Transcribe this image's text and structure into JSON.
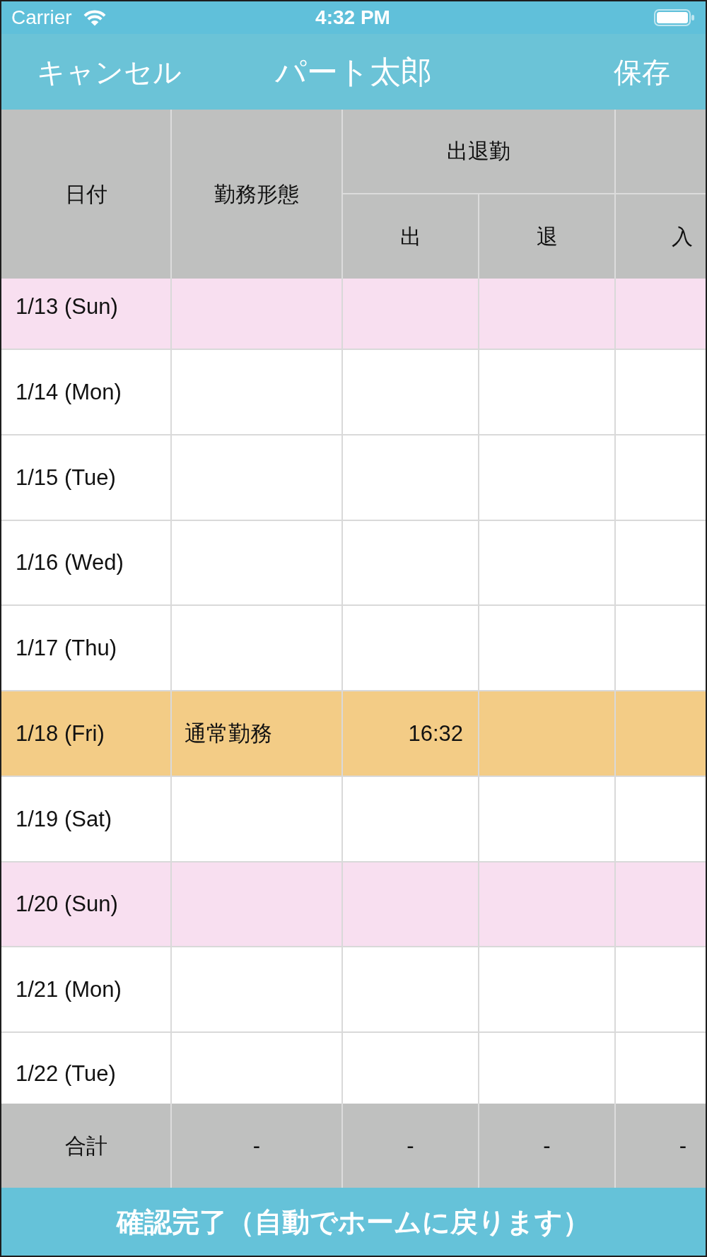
{
  "status_bar": {
    "carrier": "Carrier",
    "time": "4:32 PM"
  },
  "nav_bar": {
    "cancel_button": "キャンセル",
    "title": "パート太郎",
    "save_button": "保存"
  },
  "table": {
    "columns": [
      {
        "label": "日付"
      },
      {
        "label": "勤務形態"
      },
      {
        "label": "出退勤",
        "children": [
          {
            "label": "出"
          },
          {
            "label": "退"
          }
        ]
      },
      {
        "children": [
          {
            "label": "入"
          }
        ]
      }
    ],
    "rows": [
      {
        "date": "1/13 (Sun)",
        "color": "#f8dff0"
      },
      {
        "date": "1/14 (Mon)",
        "color": "#ffffff"
      },
      {
        "date": "1/15 (Tue)",
        "color": "#ffffff"
      },
      {
        "date": "1/16 (Wed)",
        "color": "#ffffff"
      },
      {
        "date": "1/17 (Thu)",
        "color": "#ffffff"
      },
      {
        "date": "1/18 (Fri)",
        "work_type": "通常勤務",
        "clock_in": "16:32",
        "color": "#f3cc86"
      },
      {
        "date": "1/19 (Sat)",
        "color": "#ffffff"
      },
      {
        "date": "1/20 (Sun)",
        "color": "#f8dff0"
      },
      {
        "date": "1/21 (Mon)",
        "color": "#ffffff"
      },
      {
        "date": "1/22 (Tue)",
        "color": "#ffffff"
      }
    ],
    "totals": {
      "label": "合計",
      "values": [
        "-",
        "-",
        "-",
        "-"
      ]
    }
  },
  "confirm_button": "確認完了（自動でホームに戻ります）"
}
